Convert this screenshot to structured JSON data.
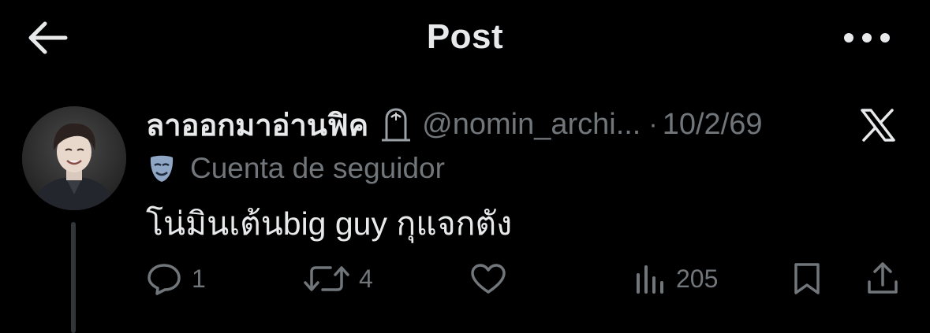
{
  "header": {
    "title": "Post",
    "back_icon": "arrow-left-icon",
    "more_icon": "more-horizontal-icon"
  },
  "post": {
    "display_name": "ลาออกมาอ่านฟิค",
    "name_badge_icon": "tombstone-emoji-icon",
    "handle": "@nomin_archi...",
    "separator": "·",
    "date": "10/2/69",
    "platform_icon": "x-logo-icon",
    "community_icon": "performing-arts-mask-icon",
    "community_label": "Cuenta de seguidor",
    "text": "โน่มินเต้นbig guy กุแจกตัง"
  },
  "actions": {
    "replies": "1",
    "reposts": "4",
    "likes": "",
    "views": "205",
    "reply_icon": "reply-icon",
    "repost_icon": "repost-icon",
    "like_icon": "heart-icon",
    "views_icon": "views-chart-icon",
    "bookmark_icon": "bookmark-icon",
    "share_icon": "share-icon"
  },
  "colors": {
    "background": "#000000",
    "primary_text": "#e7e9ea",
    "secondary_text": "#71767b",
    "thread_line": "#333639"
  }
}
